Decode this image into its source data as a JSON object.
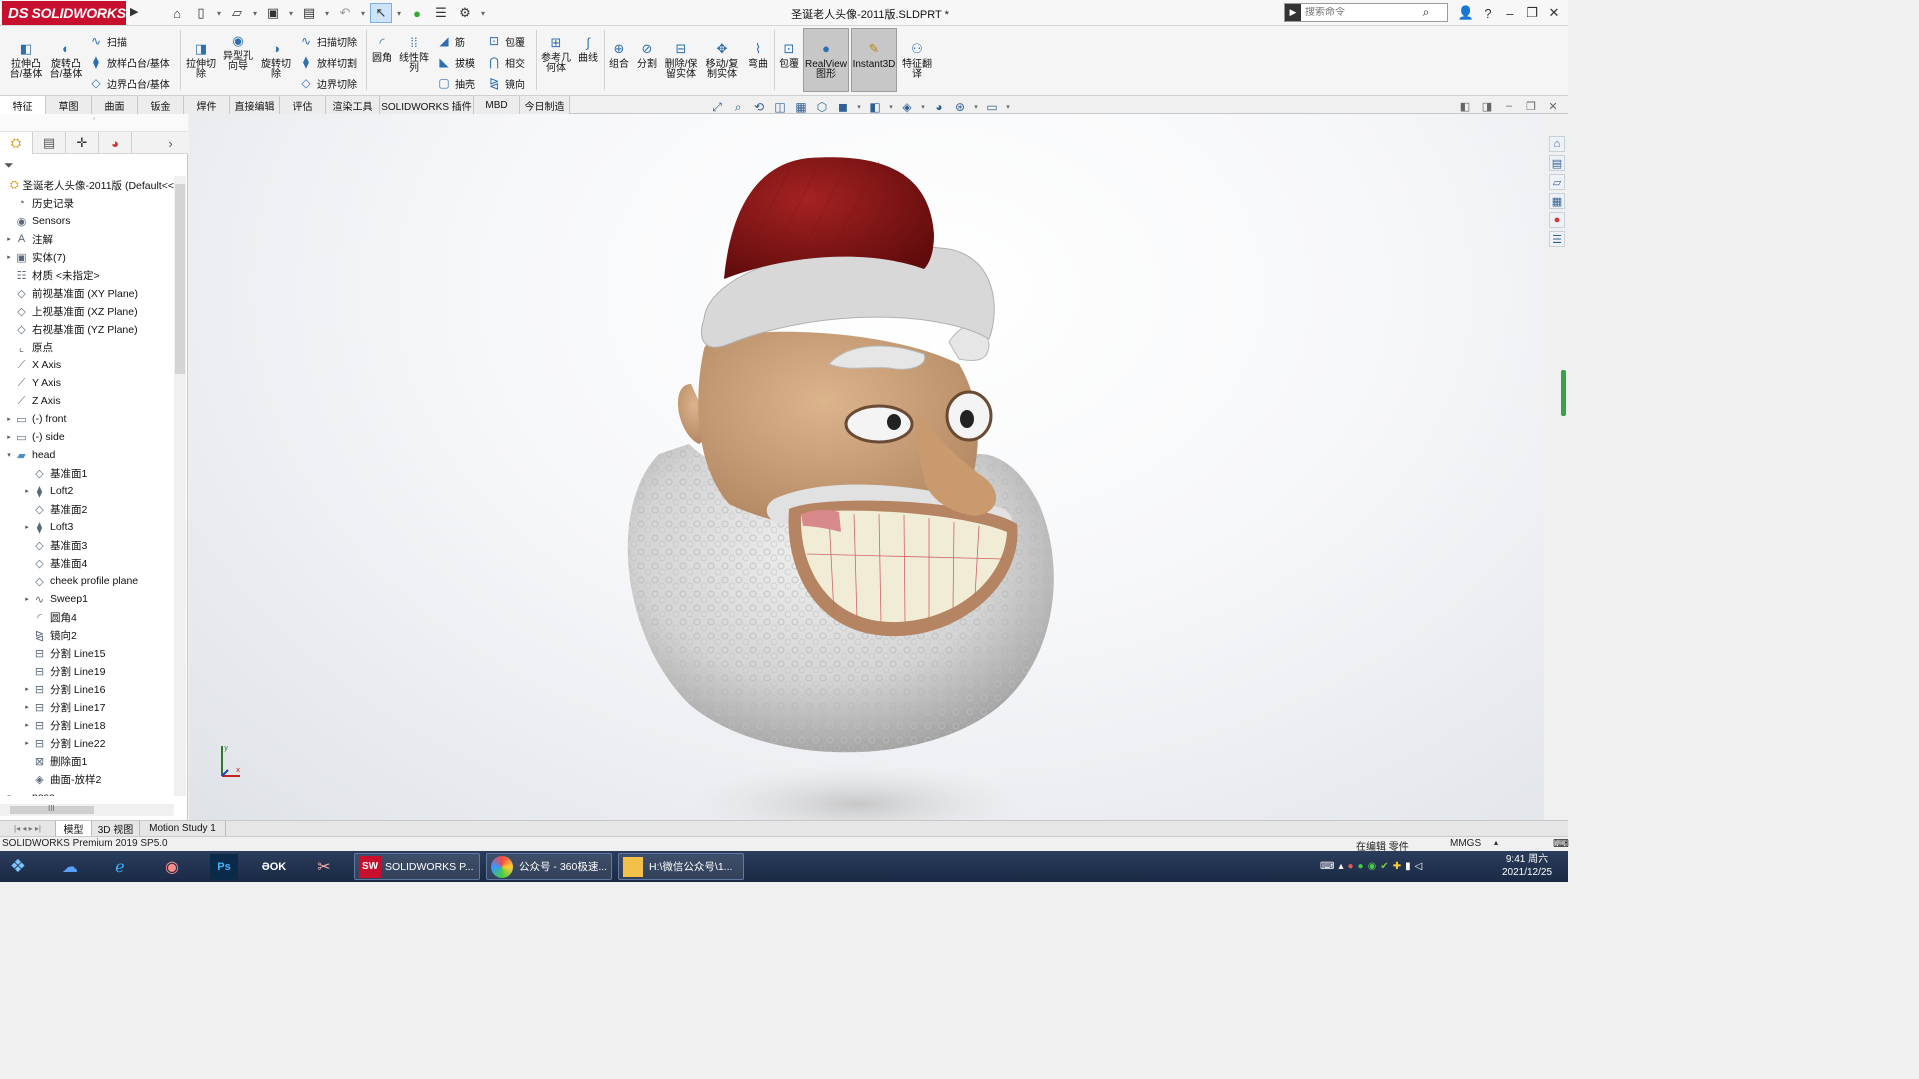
{
  "title_bar": {
    "logo_text": "SOLIDWORKS",
    "logo_mark": "DS",
    "document_title": "圣诞老人头像-2011版.SLDPRT *",
    "search_placeholder": "搜索命令",
    "quick_icons": [
      "home-icon",
      "new-document-icon",
      "open-folder-icon",
      "save-icon",
      "print-icon",
      "undo-icon",
      "select-arrow-icon",
      "rebuild-icon",
      "file-properties-icon",
      "options-gear-icon"
    ],
    "right_icons": [
      "user-icon",
      "help-icon",
      "minimize-icon",
      "restore-icon",
      "close-icon"
    ]
  },
  "ribbon": {
    "large_buttons": [
      {
        "id": "extrude-boss",
        "label": "拉伸凸\n台/基体"
      },
      {
        "id": "revolve-boss",
        "label": "旋转凸\n台/基体"
      },
      {
        "id": "extrude-cut",
        "label": "拉伸切\n除"
      },
      {
        "id": "hole-wizard",
        "label": "异型孔\n向导"
      },
      {
        "id": "revolve-cut",
        "label": "旋转切\n除"
      },
      {
        "id": "fillet",
        "label": "圆角"
      },
      {
        "id": "linear-pattern",
        "label": "线性阵\n列"
      },
      {
        "id": "reference-geometry",
        "label": "参考几\n何体"
      },
      {
        "id": "curves",
        "label": "曲线"
      },
      {
        "id": "combine",
        "label": "组合"
      },
      {
        "id": "split",
        "label": "分割"
      },
      {
        "id": "delete-keep-body",
        "label": "删除/保\n留实体"
      },
      {
        "id": "move-copy-body",
        "label": "移动/复\n制实体"
      },
      {
        "id": "flex",
        "label": "弯曲"
      },
      {
        "id": "wrap",
        "label": "包覆"
      },
      {
        "id": "realview",
        "label": "RealView\n图形"
      },
      {
        "id": "instant3d",
        "label": "Instant3D"
      },
      {
        "id": "feature-works",
        "label": "特征翻\n译"
      }
    ],
    "small_buttons": [
      {
        "id": "swept-boss",
        "label": "扫描"
      },
      {
        "id": "lofted-boss",
        "label": "放样凸台/基体"
      },
      {
        "id": "boundary-boss",
        "label": "边界凸台/基体"
      },
      {
        "id": "swept-cut",
        "label": "扫描切除"
      },
      {
        "id": "lofted-cut",
        "label": "放样切割"
      },
      {
        "id": "boundary-cut",
        "label": "边界切除"
      },
      {
        "id": "rib",
        "label": "筋"
      },
      {
        "id": "draft",
        "label": "拔模"
      },
      {
        "id": "shell",
        "label": "抽壳"
      },
      {
        "id": "wrap-small",
        "label": "包覆"
      },
      {
        "id": "intersect",
        "label": "相交"
      },
      {
        "id": "mirror",
        "label": "镜向"
      }
    ]
  },
  "command_tabs": [
    "特征",
    "草图",
    "曲面",
    "钣金",
    "焊件",
    "直接编辑",
    "评估",
    "渲染工具",
    "SOLIDWORKS 插件",
    "MBD",
    "今日制造"
  ],
  "feature_tree": {
    "items": [
      {
        "label": "圣诞老人头像-2011版  (Default<<",
        "icon": "part",
        "depth": 0,
        "expand": ""
      },
      {
        "label": "历史记录",
        "icon": "history",
        "depth": 1,
        "expand": ""
      },
      {
        "label": "Sensors",
        "icon": "sensor",
        "depth": 1,
        "expand": ""
      },
      {
        "label": "注解",
        "icon": "annotation",
        "depth": 1,
        "expand": "▸"
      },
      {
        "label": "实体(7)",
        "icon": "solid-bodies",
        "depth": 1,
        "expand": "▸"
      },
      {
        "label": "材质 <未指定>",
        "icon": "material",
        "depth": 1,
        "expand": ""
      },
      {
        "label": "前视基准面 (XY Plane)",
        "icon": "plane",
        "depth": 1,
        "expand": ""
      },
      {
        "label": "上视基准面 (XZ Plane)",
        "icon": "plane",
        "depth": 1,
        "expand": ""
      },
      {
        "label": "右视基准面 (YZ Plane)",
        "icon": "plane",
        "depth": 1,
        "expand": ""
      },
      {
        "label": "原点",
        "icon": "origin",
        "depth": 1,
        "expand": ""
      },
      {
        "label": "X Axis",
        "icon": "axis",
        "depth": 1,
        "expand": ""
      },
      {
        "label": "Y Axis",
        "icon": "axis",
        "depth": 1,
        "expand": ""
      },
      {
        "label": "Z Axis",
        "icon": "axis",
        "depth": 1,
        "expand": ""
      },
      {
        "label": "(-) front",
        "icon": "sketch",
        "depth": 1,
        "expand": "▸"
      },
      {
        "label": "(-) side",
        "icon": "sketch",
        "depth": 1,
        "expand": "▸"
      },
      {
        "label": "head",
        "icon": "folder",
        "depth": 1,
        "expand": "▾"
      },
      {
        "label": "基准面1",
        "icon": "plane",
        "depth": 2,
        "expand": ""
      },
      {
        "label": "Loft2",
        "icon": "loft",
        "depth": 2,
        "expand": "▸"
      },
      {
        "label": "基准面2",
        "icon": "plane",
        "depth": 2,
        "expand": ""
      },
      {
        "label": "Loft3",
        "icon": "loft",
        "depth": 2,
        "expand": "▸"
      },
      {
        "label": "基准面3",
        "icon": "plane",
        "depth": 2,
        "expand": ""
      },
      {
        "label": "基准面4",
        "icon": "plane",
        "depth": 2,
        "expand": ""
      },
      {
        "label": "cheek profile plane",
        "icon": "plane",
        "depth": 2,
        "expand": ""
      },
      {
        "label": "Sweep1",
        "icon": "sweep",
        "depth": 2,
        "expand": "▸"
      },
      {
        "label": "圆角4",
        "icon": "fillet",
        "depth": 2,
        "expand": ""
      },
      {
        "label": "镜向2",
        "icon": "mirror",
        "depth": 2,
        "expand": ""
      },
      {
        "label": "分割 Line15",
        "icon": "split-line",
        "depth": 2,
        "expand": ""
      },
      {
        "label": "分割 Line19",
        "icon": "split-line",
        "depth": 2,
        "expand": ""
      },
      {
        "label": "分割 Line16",
        "icon": "split-line",
        "depth": 2,
        "expand": "▸"
      },
      {
        "label": "分割 Line17",
        "icon": "split-line",
        "depth": 2,
        "expand": "▸"
      },
      {
        "label": "分割 Line18",
        "icon": "split-line",
        "depth": 2,
        "expand": "▸"
      },
      {
        "label": "分割 Line22",
        "icon": "split-line",
        "depth": 2,
        "expand": "▸"
      },
      {
        "label": "删除面1",
        "icon": "delete-face",
        "depth": 2,
        "expand": ""
      },
      {
        "label": "曲面-放样2",
        "icon": "surface-loft",
        "depth": 2,
        "expand": ""
      },
      {
        "label": "nose",
        "icon": "folder",
        "depth": 1,
        "expand": "▾"
      }
    ],
    "scroll_label": "III"
  },
  "bottom_tabs": [
    "模型",
    "3D 视图",
    "Motion Study 1"
  ],
  "status_bar": {
    "product": "SOLIDWORKS Premium 2019 SP5.0",
    "state": "在编辑 零件",
    "units": "MMGS"
  },
  "taskbar": {
    "items": [
      {
        "label": "SOLIDWORKS P...",
        "icon": "solidworks-icon"
      },
      {
        "label": "公众号 - 360极速...",
        "icon": "browser-icon"
      },
      {
        "label": "H:\\微信公众号\\1...",
        "icon": "folder-icon"
      }
    ],
    "time": "9:41 周六",
    "date": "2021/12/25"
  },
  "colors": {
    "hat_red": "#8f1515",
    "fur_white": "#dcdcdc",
    "skin": "#caa27a",
    "brand_red": "#c8102e"
  }
}
